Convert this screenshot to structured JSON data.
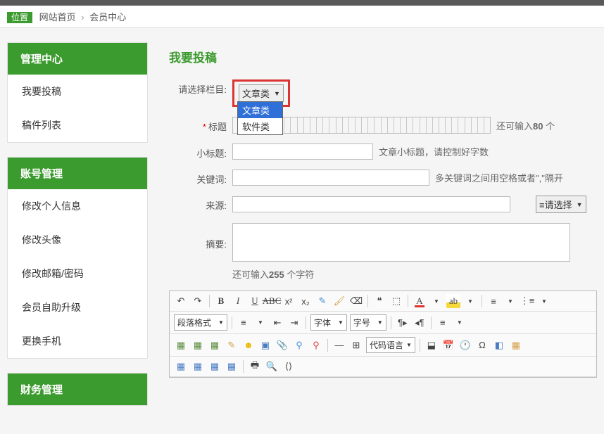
{
  "breadcrumb": {
    "location_label": "位置",
    "home": "网站首页",
    "current": "会员中心"
  },
  "sidebar": {
    "panels": [
      {
        "title": "管理中心",
        "items": [
          "我要投稿",
          "稿件列表"
        ]
      },
      {
        "title": "账号管理",
        "items": [
          "修改个人信息",
          "修改头像",
          "修改邮箱/密码",
          "会员自助升级",
          "更换手机"
        ]
      },
      {
        "title": "财务管理",
        "items": []
      }
    ]
  },
  "page": {
    "title": "我要投稿"
  },
  "form": {
    "category_label": "请选择栏目",
    "category_value": "文章类",
    "category_options": [
      "文章类",
      "软件类"
    ],
    "title_label": "标题",
    "title_hint_prefix": "还可输入",
    "title_hint_count": "80",
    "title_hint_suffix": " 个",
    "subtitle_label": "小标题",
    "subtitle_hint": "文章小标题，请控制好字数",
    "keywords_label": "关键词",
    "keywords_hint": "多关键词之间用空格或者\",\"隔开",
    "source_label": "来源",
    "source_select": "≡请选择",
    "summary_label": "摘要",
    "summary_hint_prefix": "还可输入",
    "summary_hint_count": "255",
    "summary_hint_suffix": " 个字符"
  },
  "editor": {
    "para_format": "段落格式",
    "font_family": "字体",
    "font_size": "字号",
    "code_lang": "代码语言"
  }
}
